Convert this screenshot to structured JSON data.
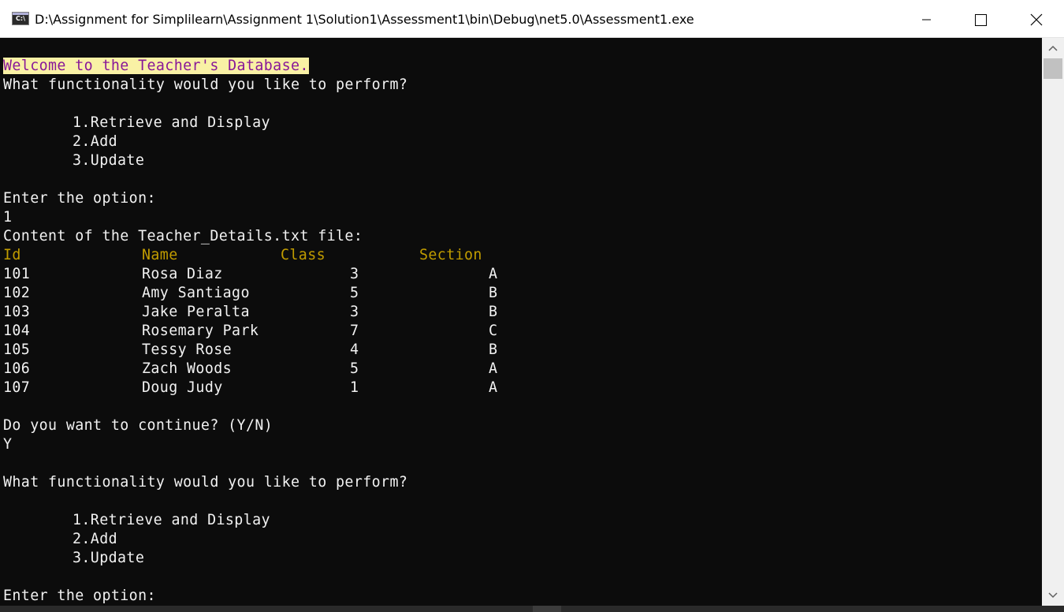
{
  "window": {
    "title": "D:\\Assignment for Simplilearn\\Assignment 1\\Solution1\\Assessment1\\bin\\Debug\\net5.0\\Assessment1.exe",
    "icon_name": "console-app-icon",
    "icon_text": "C:\\",
    "buttons": {
      "minimize": "minimize-icon",
      "maximize": "maximize-icon",
      "close": "close-icon"
    }
  },
  "colors": {
    "background": "#0c0c0c",
    "text": "#f2f2f2",
    "welcome_bg": "#f9f1a5",
    "welcome_fg": "#881798",
    "header": "#c19c00"
  },
  "console": {
    "welcome": "Welcome to the Teacher's Database.",
    "prompt1": "What functionality would you like to perform?",
    "menu1": [
      "1.Retrieve and Display",
      "2.Add",
      "3.Update"
    ],
    "enter_option1": "Enter the option:",
    "input1": "1",
    "content_label": "Content of the Teacher_Details.txt file:",
    "table": {
      "headers": [
        "Id",
        "Name",
        "Class",
        "Section"
      ],
      "rows": [
        [
          "101",
          "Rosa Diaz",
          "3",
          "A"
        ],
        [
          "102",
          "Amy Santiago",
          "5",
          "B"
        ],
        [
          "103",
          "Jake Peralta",
          "3",
          "B"
        ],
        [
          "104",
          "Rosemary Park",
          "7",
          "C"
        ],
        [
          "105",
          "Tessy Rose",
          "4",
          "B"
        ],
        [
          "106",
          "Zach Woods",
          "5",
          "A"
        ],
        [
          "107",
          "Doug Judy",
          "1",
          "A"
        ]
      ]
    },
    "continue_prompt": "Do you want to continue? (Y/N)",
    "continue_input": "Y",
    "prompt2": "What functionality would you like to perform?",
    "menu2": [
      "1.Retrieve and Display",
      "2.Add",
      "3.Update"
    ],
    "enter_option2": "Enter the option:"
  },
  "scrollbar": {
    "up_icon": "scroll-up-arrow-icon",
    "down_icon": "scroll-down-arrow-icon"
  }
}
